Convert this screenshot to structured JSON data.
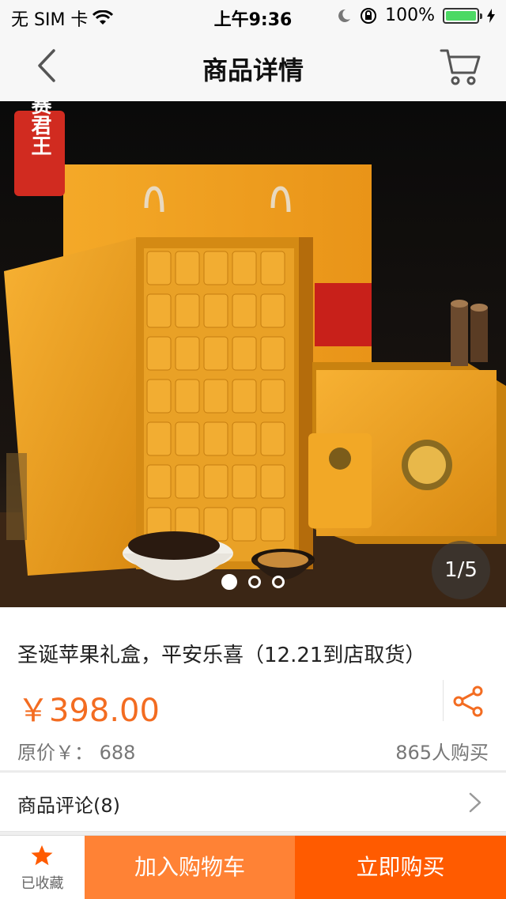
{
  "status_bar": {
    "carrier": "无 SIM 卡",
    "time": "上午9:36",
    "battery": "100%",
    "battery_level": 1.0,
    "icons": [
      "wifi-icon",
      "moon-icon",
      "rotation-lock-icon",
      "battery-icon"
    ]
  },
  "nav": {
    "title": "商品详情",
    "back_icon": "back-chevron-icon",
    "cart_icon": "cart-icon"
  },
  "hero": {
    "counter": "1/5",
    "current_index": 1,
    "total": 5,
    "pager_dots": 3,
    "logo_text": "赛君王"
  },
  "product": {
    "title": "圣诞苹果礼盒，平安乐喜（12.21到店取货）",
    "price": "￥398.00",
    "original_price": "原价￥：  688",
    "buyers": "865人购买",
    "share_icon": "share-icon"
  },
  "review": {
    "label": "商品评论(8)",
    "chevron_icon": "chevron-right-icon"
  },
  "bottom_bar": {
    "favorite_label": "已收藏",
    "favorite_icon": "star-icon",
    "add_to_cart": "加入购物车",
    "buy_now": "立即购买"
  },
  "colors": {
    "accent_orange": "#ff5b00",
    "cart_orange": "#ff8235",
    "price_orange": "#f36c21",
    "battery_green": "#4cd964"
  }
}
